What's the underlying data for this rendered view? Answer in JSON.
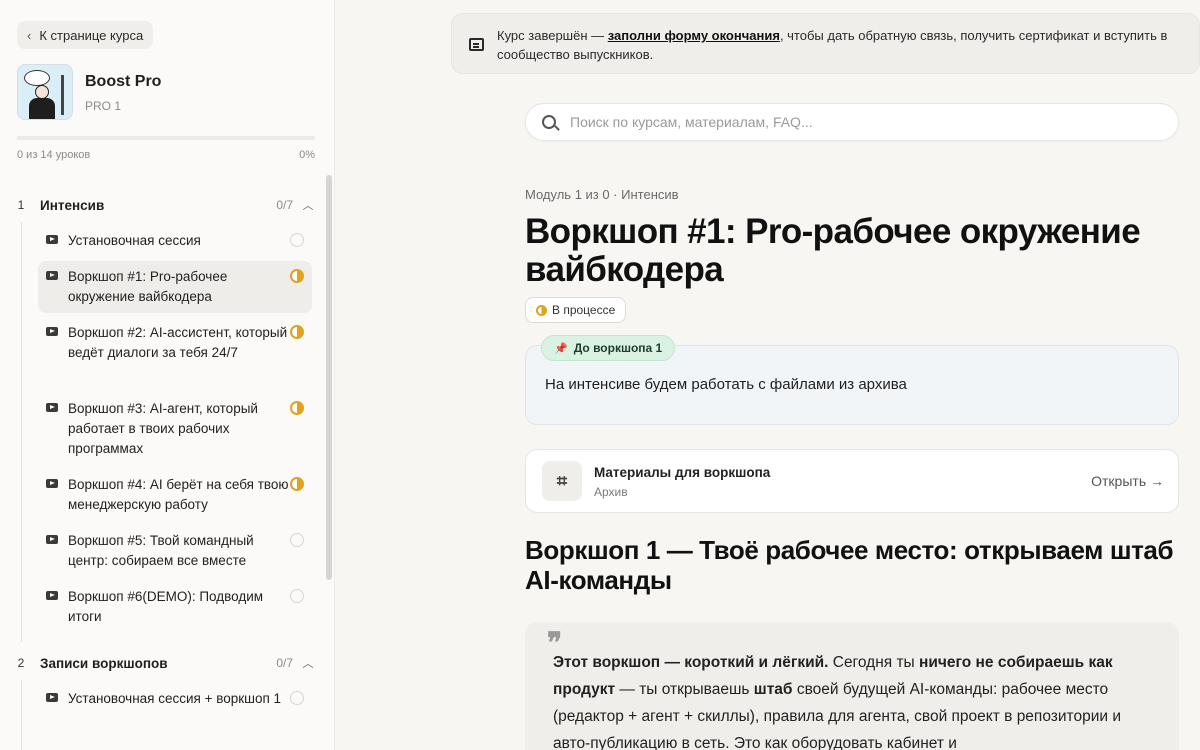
{
  "sidebar": {
    "back_label": "К странице курса",
    "course": {
      "title": "Boost Pro",
      "subtitle": "PRO 1"
    },
    "progress": {
      "text": "0 из 14 уроков",
      "percent_label": "0%",
      "fraction": 0.0
    },
    "modules": [
      {
        "num": "1",
        "title": "Интенсив",
        "count": "0/7",
        "lessons": [
          {
            "title": "Установочная сессия",
            "status": "not-started"
          },
          {
            "title": "Воркшоп #1: Pro-рабочее окружение вайбкодера",
            "status": "in-progress",
            "active": true
          },
          {
            "title": "Воркшоп #2: AI-ассистент, который ведёт диалоги за тебя 24/7",
            "status": "in-progress"
          },
          {
            "title": "Воркшоп #3: AI-агент, который работает в твоих рабочих программах",
            "status": "in-progress"
          },
          {
            "title": "Воркшоп #4: AI берёт на себя твою менеджерскую работу",
            "status": "in-progress"
          },
          {
            "title": "Воркшоп #5: Твой командный центр: собираем все вместе",
            "status": "not-started"
          },
          {
            "title": "Воркшоп #6(DEMO): Подводим итоги",
            "status": "not-started"
          }
        ]
      },
      {
        "num": "2",
        "title": "Записи воркшопов",
        "count": "0/7",
        "lessons": [
          {
            "title": "Установочная сессия + воркшоп 1",
            "status": "not-started"
          }
        ]
      }
    ]
  },
  "banner": {
    "prefix": "Курс завершён — ",
    "link": "заполни форму окончания",
    "suffix": ", чтобы дать обратную связь, получить сертификат и вступить в сообщество выпускников."
  },
  "search": {
    "placeholder": "Поиск по курсам, материалам, FAQ..."
  },
  "main": {
    "breadcrumb": "Модуль 1 из 0 · Интенсив",
    "title": "Воркшоп #1: Pro-рабочее окружение вайбкодера",
    "status_badge": "В процессе",
    "note": {
      "tag": "До воркшопа 1",
      "text": "На интенсиве будем работать с файлами из архива"
    },
    "material": {
      "title": "Материалы для воркшопа",
      "subtitle": "Архив",
      "open_label": "Открыть →"
    },
    "section_title": "Воркшоп 1 — Твоё рабочее место: открываем штаб AI-команды",
    "quote": {
      "b1": "Этот воркшоп — короткий и лёгкий.",
      "t1": " Сегодня ты ",
      "b2": "ничего не собираешь как продукт",
      "t2": " — ты открываешь ",
      "b3": "штаб",
      "t3": " своей будущей AI-команды: рабочее место (редактор + агент + скиллы), правила для агента, свой проект в репозитории и авто-публикацию в сеть. Это как оборудовать кабинет и"
    }
  },
  "colors": {
    "accent": "#e0a31f",
    "tag_green": "#d9f2e2",
    "note_bg": "#f2f5f8"
  }
}
